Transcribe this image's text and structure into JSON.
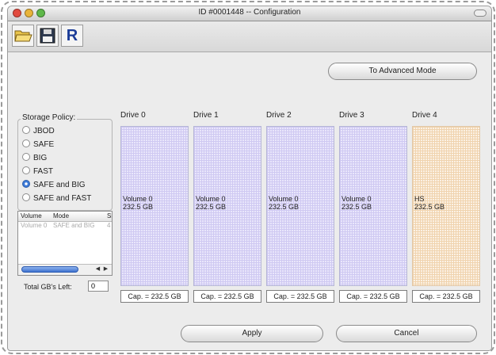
{
  "window": {
    "title": "ID #0001448 -- Configuration"
  },
  "toolbar": {
    "r_label": "R"
  },
  "buttons": {
    "advanced": "To Advanced Mode",
    "apply": "Apply",
    "cancel": "Cancel"
  },
  "policy": {
    "title": "Storage Policy:",
    "options": [
      "JBOD",
      "SAFE",
      "BIG",
      "FAST",
      "SAFE and BIG",
      "SAFE and FAST"
    ],
    "selected": "SAFE and BIG"
  },
  "volume_table": {
    "headers": [
      "Volume",
      "Mode",
      "Si"
    ],
    "rows": [
      [
        "Volume 0",
        "SAFE and BIG",
        "4"
      ]
    ]
  },
  "total": {
    "label": "Total GB's Left:",
    "value": "0"
  },
  "drives": [
    {
      "label": "Drive 0",
      "volume": "Volume 0",
      "size": "232.5 GB",
      "cap": "Cap. = 232.5 GB"
    },
    {
      "label": "Drive 1",
      "volume": "Volume 0",
      "size": "232.5 GB",
      "cap": "Cap. = 232.5 GB"
    },
    {
      "label": "Drive 2",
      "volume": "Volume 0",
      "size": "232.5 GB",
      "cap": "Cap. = 232.5 GB"
    },
    {
      "label": "Drive 3",
      "volume": "Volume 0",
      "size": "232.5 GB",
      "cap": "Cap. = 232.5 GB"
    },
    {
      "label": "Drive 4",
      "volume": "HS",
      "size": "232.5 GB",
      "cap": "Cap. = 232.5 GB"
    }
  ],
  "colors": {
    "volume_fill": "#e9e6fb",
    "hotspare_fill": "#fbf1e4",
    "radio_selected": "#3d7bd9"
  },
  "icons": [
    "open-folder-icon",
    "save-floppy-icon"
  ]
}
